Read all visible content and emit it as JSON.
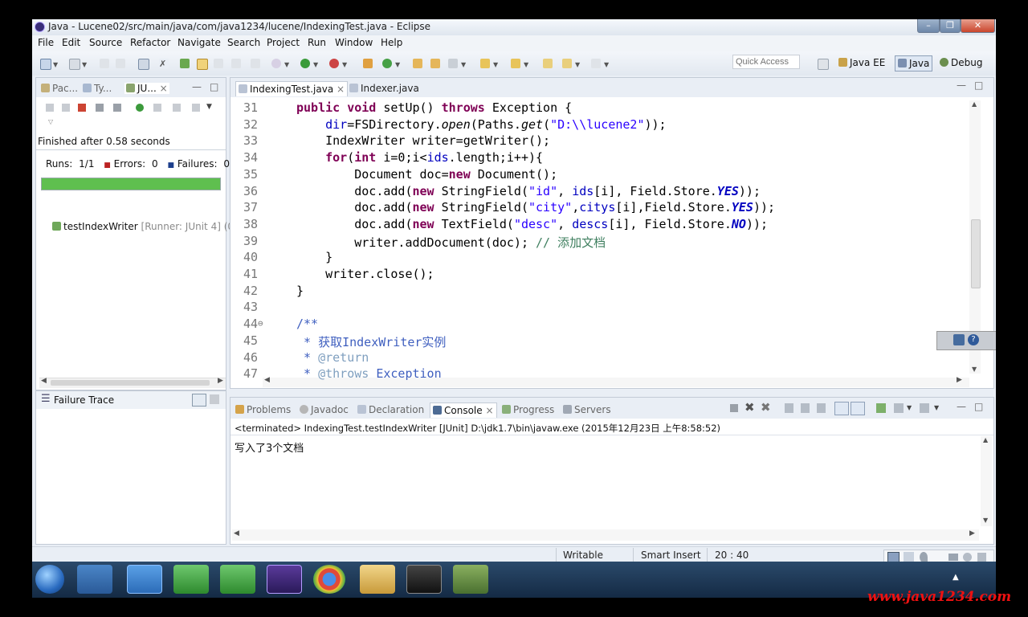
{
  "window": {
    "title": "Java - Lucene02/src/main/java/com/java1234/lucene/IndexingTest.java - Eclipse"
  },
  "menu": [
    "File",
    "Edit",
    "Source",
    "Refactor",
    "Navigate",
    "Search",
    "Project",
    "Run",
    "Window",
    "Help"
  ],
  "toolbar": {
    "quick_access_placeholder": "Quick Access",
    "perspectives": [
      "Java EE",
      "Java",
      "Debug"
    ]
  },
  "left_panel": {
    "tabs": [
      "Pac...",
      "Ty...",
      "JU..."
    ],
    "finished": "Finished after 0.58 seconds",
    "runs_label": "Runs:",
    "runs_value": "1/1",
    "errors_label": "Errors:",
    "errors_value": "0",
    "failures_label": "Failures:",
    "failures_value": "0",
    "progress": 1.0,
    "tree_item": "testIndexWriter",
    "tree_item_runner": "[Runner: JUnit 4] (0.",
    "failure_trace": "Failure Trace"
  },
  "editor": {
    "tabs": [
      "IndexingTest.java",
      "Indexer.java"
    ],
    "line_numbers": [
      "31",
      "32",
      "33",
      "34",
      "35",
      "36",
      "37",
      "38",
      "39",
      "40",
      "41",
      "42",
      "43",
      "44",
      "45",
      "46",
      "47"
    ]
  },
  "bottom_panel": {
    "tabs": [
      "Problems",
      "Javadoc",
      "Declaration",
      "Console",
      "Progress",
      "Servers"
    ],
    "console_header": "<terminated> IndexingTest.testIndexWriter [JUnit] D:\\jdk1.7\\bin\\javaw.exe (2015年12月23日 上午8:58:52)",
    "console_output": "写入了3个文档"
  },
  "status": {
    "writable": "Writable",
    "insert_mode": "Smart Insert",
    "position": "20 : 40"
  },
  "taskbar": {
    "watermark": "www.java1234.com"
  },
  "colors": {
    "keyword": "#7f0055",
    "string": "#2a00ff",
    "field": "#0000c0",
    "javadoc": "#3f5fbf",
    "comment": "#3f7f5f",
    "junit_bar": "#5fbf4f"
  }
}
